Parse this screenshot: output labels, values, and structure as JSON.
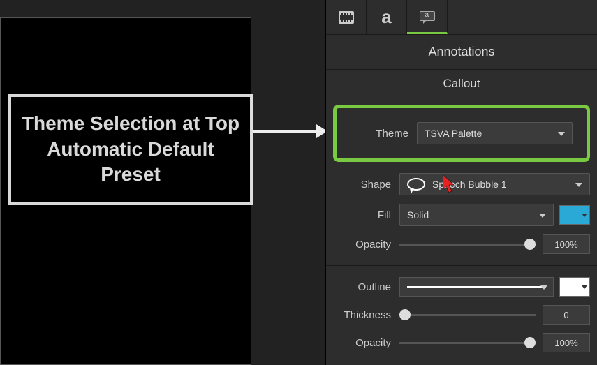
{
  "canvas": {
    "callout_text": "Theme Selection at Top Automatic Default Preset"
  },
  "panel": {
    "title": "Annotations",
    "subtitle": "Callout",
    "theme": {
      "label": "Theme",
      "value": "TSVA Palette"
    },
    "shape": {
      "label": "Shape",
      "value": "Speech Bubble 1"
    },
    "fill": {
      "label": "Fill",
      "value": "Solid",
      "color": "#2aa9d6",
      "opacity_label": "Opacity",
      "opacity_value": "100%",
      "opacity_slider": 100
    },
    "outline": {
      "label": "Outline",
      "color": "#ffffff",
      "thickness_label": "Thickness",
      "thickness_value": "0",
      "thickness_slider": 0,
      "opacity_label": "Opacity",
      "opacity_value": "100%",
      "opacity_slider": 100
    }
  }
}
